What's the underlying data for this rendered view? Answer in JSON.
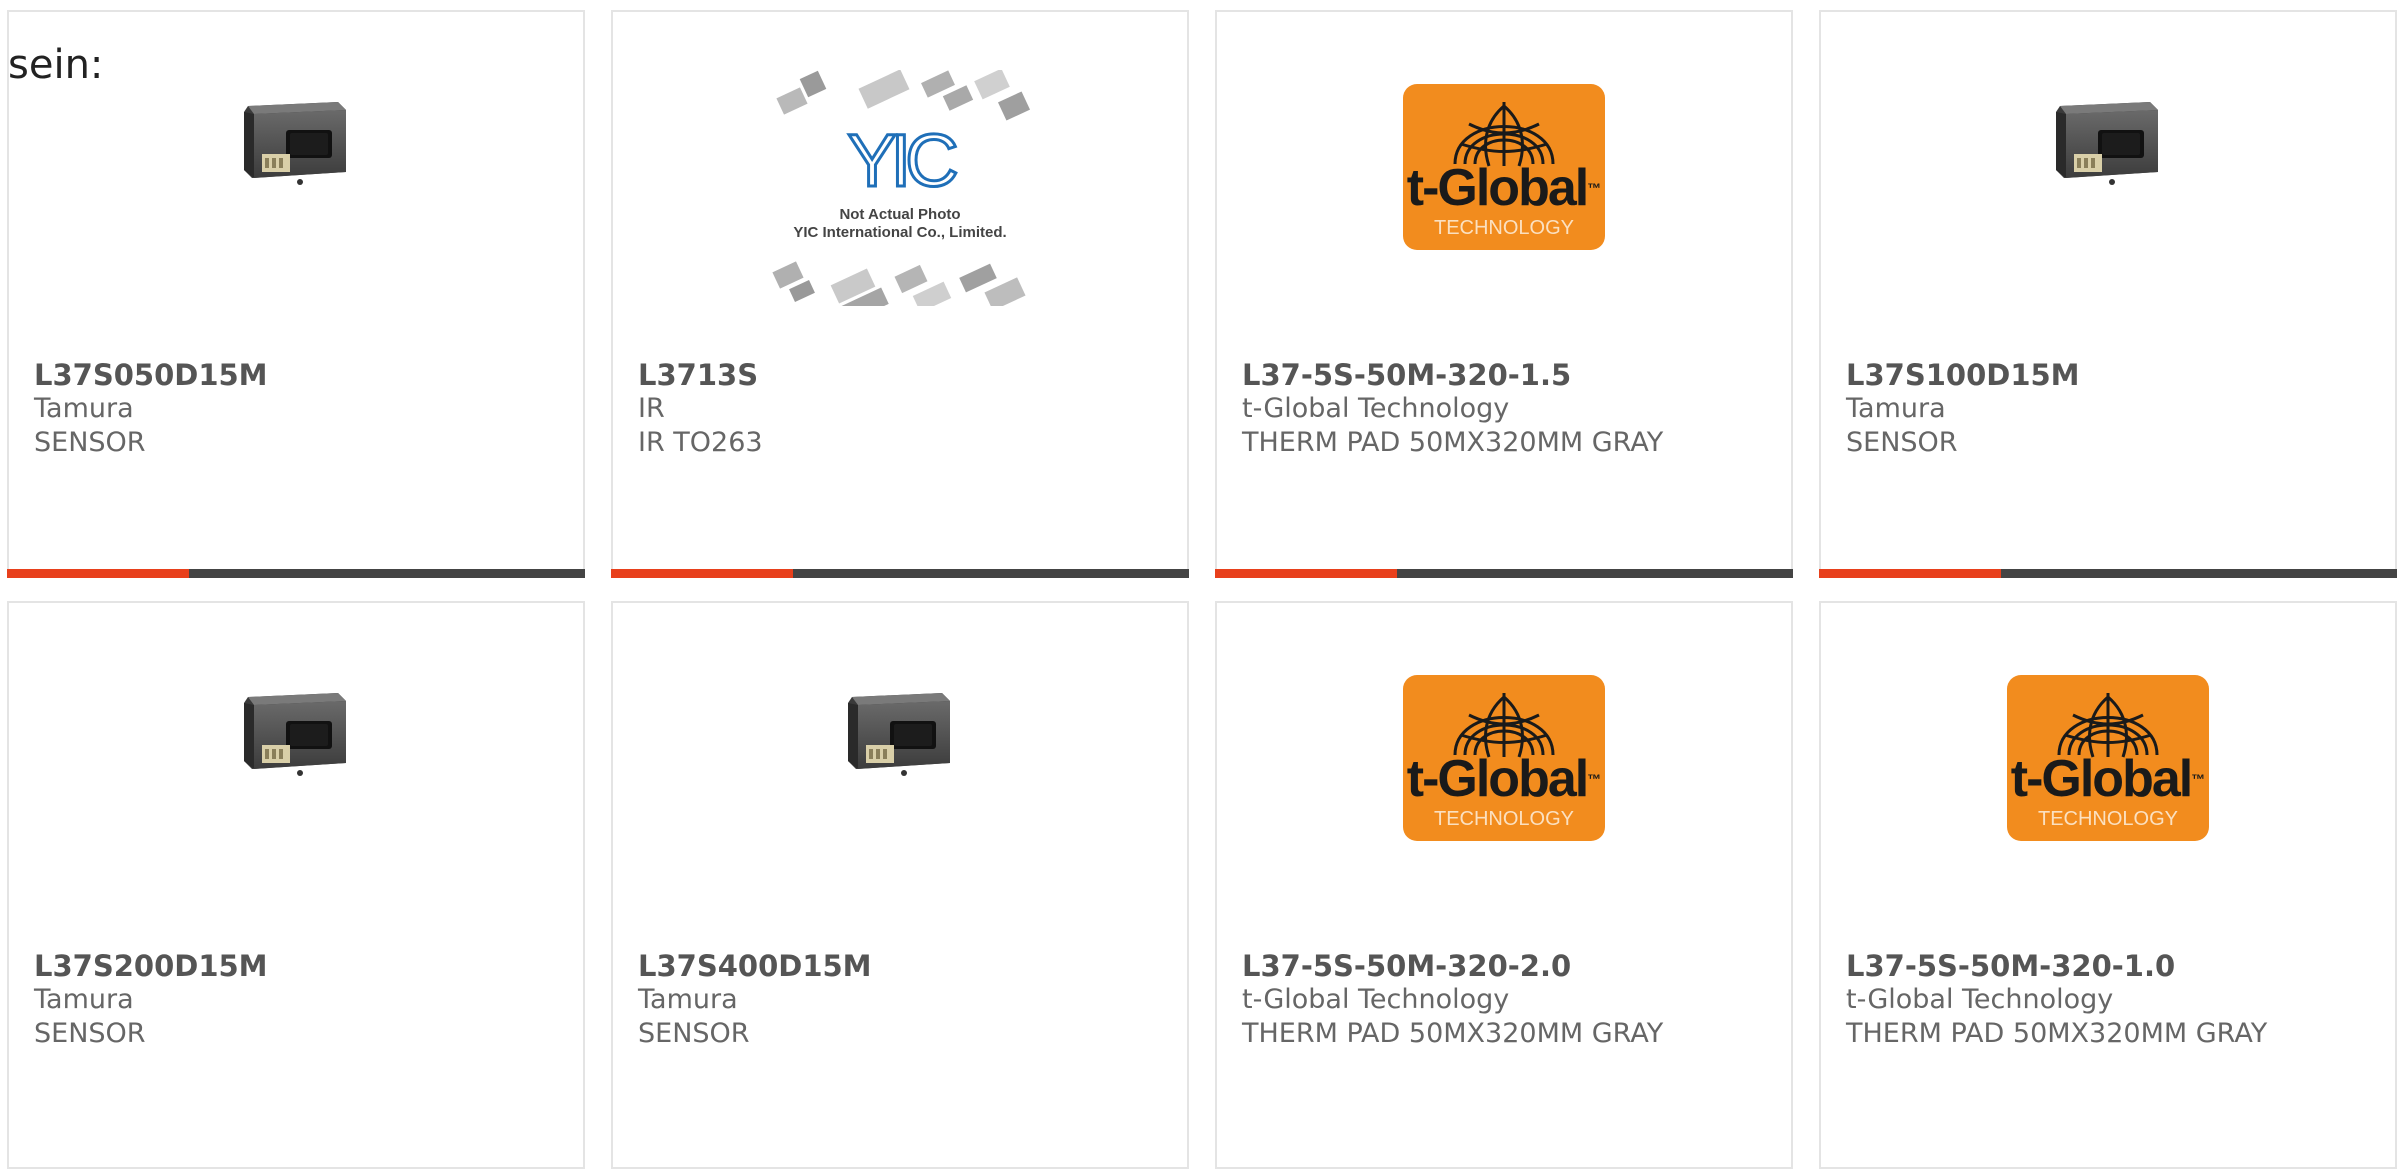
{
  "intro": {
    "text": "sein:"
  },
  "colors": {
    "accent": "#e8401c",
    "bar": "#444444",
    "border": "#e4e4e4",
    "tglobal_orange": "#f28c1e",
    "yic_blue": "#1f6fb8"
  },
  "products": [
    {
      "part_number": "L37S050D15M",
      "manufacturer": "Tamura",
      "description": "SENSOR",
      "image": "tamura-sensor-icon"
    },
    {
      "part_number": "L3713S",
      "manufacturer": "IR",
      "description": "IR TO263",
      "image": "yic-placeholder-icon",
      "image_text": {
        "brand": "YIC",
        "line1": "Not Actual Photo",
        "line2": "YIC International Co., Limited."
      }
    },
    {
      "part_number": "L37-5S-50M-320-1.5",
      "manufacturer": "t-Global Technology",
      "description": "THERM PAD 50MX320MM GRAY",
      "image": "tglobal-logo-icon",
      "image_text": {
        "brand": "t-Global",
        "tm": "™",
        "sub": "TECHNOLOGY"
      }
    },
    {
      "part_number": "L37S100D15M",
      "manufacturer": "Tamura",
      "description": "SENSOR",
      "image": "tamura-sensor-icon"
    },
    {
      "part_number": "L37S200D15M",
      "manufacturer": "Tamura",
      "description": "SENSOR",
      "image": "tamura-sensor-icon"
    },
    {
      "part_number": "L37S400D15M",
      "manufacturer": "Tamura",
      "description": "SENSOR",
      "image": "tamura-sensor-icon"
    },
    {
      "part_number": "L37-5S-50M-320-2.0",
      "manufacturer": "t-Global Technology",
      "description": "THERM PAD 50MX320MM GRAY",
      "image": "tglobal-logo-icon",
      "image_text": {
        "brand": "t-Global",
        "tm": "™",
        "sub": "TECHNOLOGY"
      }
    },
    {
      "part_number": "L37-5S-50M-320-1.0",
      "manufacturer": "t-Global Technology",
      "description": "THERM PAD 50MX320MM GRAY",
      "image": "tglobal-logo-icon",
      "image_text": {
        "brand": "t-Global",
        "tm": "™",
        "sub": "TECHNOLOGY"
      }
    }
  ]
}
